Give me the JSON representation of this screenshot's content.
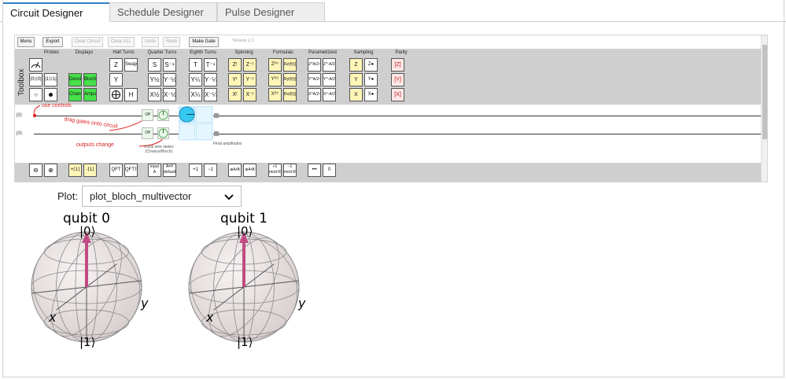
{
  "tabs": [
    "Circuit Designer",
    "Schedule Designer",
    "Pulse Designer"
  ],
  "quirk": {
    "toolbar": {
      "menu": "Menu",
      "export": "Export",
      "clear_circuit": "Clear Circuit",
      "clear_all": "Clear ALL",
      "undo": "Undo",
      "redo": "Redo",
      "make_gate": "Make Gate",
      "version": "Version 2.3"
    },
    "toolbox_label": "Toolbox",
    "categories": {
      "probes": "Probes",
      "displays": "Displays",
      "half_turns": "Half Turns",
      "quarter_turns": "Quarter Turns",
      "eighth_turns": "Eighth Turns",
      "spinning": "Spinning",
      "formulaic": "Formulaic",
      "parametrized": "Parametrized",
      "sampling": "Sampling",
      "parity": "Parity"
    },
    "gates": {
      "probe2": "|0⟩⟨0|",
      "probe3": "|1⟩⟨1|",
      "probe4": "○",
      "density": "Density",
      "bloch": "Bloch",
      "chance": "Chance",
      "amps": "Amps",
      "z": "Z",
      "swap": "Swap",
      "y": "Y",
      "h": "H",
      "s": "S",
      "s_inv": "S⁻¹",
      "y_half": "Y½",
      "y_neg_half": "Y⁻½",
      "x_half": "X½",
      "x_neg_half": "X⁻½",
      "t": "T",
      "t_inv": "T⁻¹",
      "y_quarter": "Y¼",
      "y_neg_quarter": "Y⁻¼",
      "x_quarter": "X¼",
      "x_neg_quarter": "X⁻¼",
      "z_t": "Zᵗ",
      "z_neg_t": "Z⁻ᵗ",
      "y_t": "Yᵗ",
      "y_neg_t": "Y⁻ᵗ",
      "x_t": "Xᵗ",
      "x_neg_t": "X⁻ᵗ",
      "z_ft": "Zᶠ⁽ᵗ⁾",
      "rz_ft": "Rz(f(t))",
      "y_ft": "Yᶠ⁽ᵗ⁾",
      "ry_ft": "Ry(f(t))",
      "x_ft": "Xᶠ⁽ᵗ⁾",
      "rx_ft": "Rx(f(t))",
      "z_a2": "Z^A/2ⁿ",
      "z_neg_a2": "Z^-A/2ⁿ",
      "y_a2": "Y^A/2ⁿ",
      "y_neg_a2": "Y^-A/2ⁿ",
      "x_a2": "X^A/2ⁿ",
      "x_neg_a2": "X^-A/2ⁿ",
      "samp_z": "Z",
      "samp_z2": "Z●",
      "samp_y": "Y",
      "samp_y2": "Y●",
      "samp_x": "X",
      "samp_x2": "X●",
      "par_z": "[Z]",
      "par_y": "[Y]",
      "par_x": "[X]"
    },
    "circuit": {
      "q0_label": "|0⟩",
      "q1_label": "|0⟩",
      "use_controls": "use controls",
      "drag_gates": "drag gates onto circuit",
      "outputs_change": "outputs change",
      "off0": "Off",
      "off1": "Off",
      "local_wire": "Local wire states",
      "chance_bloch": "(Chance/Bloch)",
      "final_amplitudes": "Final amplitudes"
    },
    "toolbox2": {
      "g1": "⊖",
      "g2": "⊕",
      "g3": "+⌈1⌉",
      "g4": "-⌈1⌉",
      "g5": "QFT",
      "g6": "QFT†",
      "g7": "input A",
      "g8": "A=# default",
      "g9": "+1",
      "g10": "−1",
      "g11": "⊕A•B",
      "g12": "⊕A•B",
      "g13": "+1 mod R",
      "g14": "−1 mod R",
      "g15": "•••",
      "g16": "0"
    }
  },
  "plot": {
    "label": "Plot:",
    "selected": "plot_bloch_multivector"
  },
  "blochs": [
    {
      "title": "qubit 0",
      "ket0": "|0⟩",
      "ket1": "|1⟩",
      "x_label": "x",
      "y_label": "y"
    },
    {
      "title": "qubit 1",
      "ket0": "|0⟩",
      "ket1": "|1⟩",
      "x_label": "x",
      "y_label": "y"
    }
  ],
  "colors": {
    "tab_accent": "#2f80c8",
    "arrow": "#c24b84",
    "annotation": "#dd2222",
    "gate_green": "#47e04a",
    "gate_yellow": "#fff6b8"
  }
}
